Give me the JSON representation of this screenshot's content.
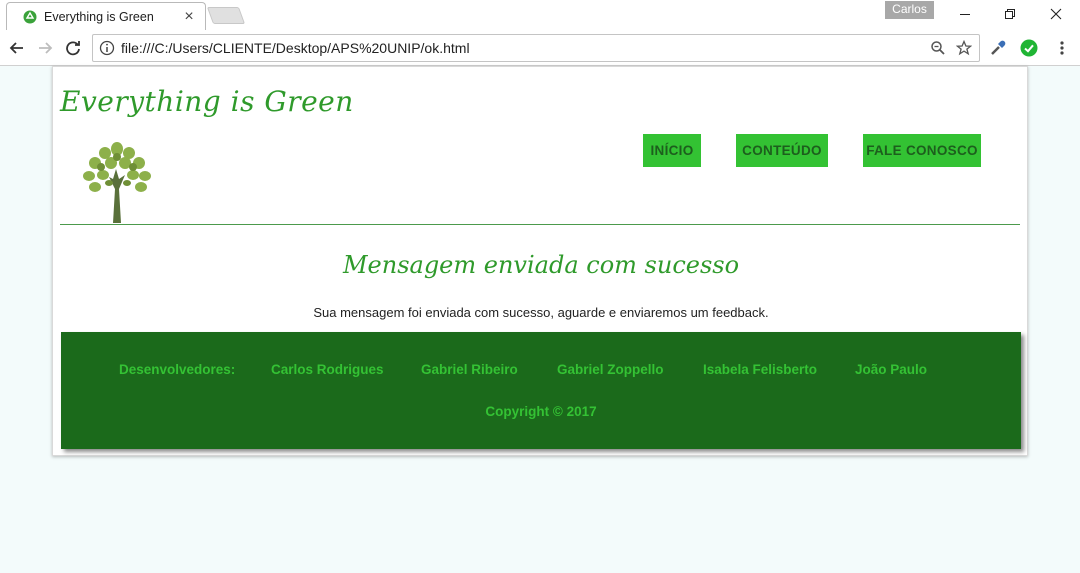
{
  "browser": {
    "tab_title": "Everything is Green",
    "profile_name": "Carlos",
    "url": "file:///C:/Users/CLIENTE/Desktop/APS%20UNIP/ok.html"
  },
  "site": {
    "title": "Everything is Green",
    "menu": [
      "INÍCIO",
      "CONTEÚDO",
      "FALE CONOSCO"
    ],
    "heading": "Mensagem enviada com sucesso",
    "message": "Sua mensagem foi enviada com sucesso, aguarde e enviaremos um feedback."
  },
  "footer": {
    "developers_label": "Desenvolvedores:",
    "developers": [
      "Carlos Rodrigues",
      "Gabriel Ribeiro",
      "Gabriel Zoppello",
      "Isabela Felisberto",
      "João Paulo"
    ],
    "copyright": "Copyright © 2017"
  },
  "colors": {
    "page_background": "#f3fbfb",
    "brand_green": "#2f9a2b",
    "menu_button": "#33c233",
    "footer_background": "#1b6a1b",
    "footer_text": "#34c234"
  },
  "icons": {
    "tab_favicon": "recycle-icon",
    "logo": "tree-logo",
    "omnibox_left": "info-icon",
    "omnibox_right": [
      "zoom-icon",
      "star-icon"
    ],
    "extensions": [
      "eyedropper-icon",
      "check-circle-icon",
      "kebab-menu-icon"
    ]
  }
}
